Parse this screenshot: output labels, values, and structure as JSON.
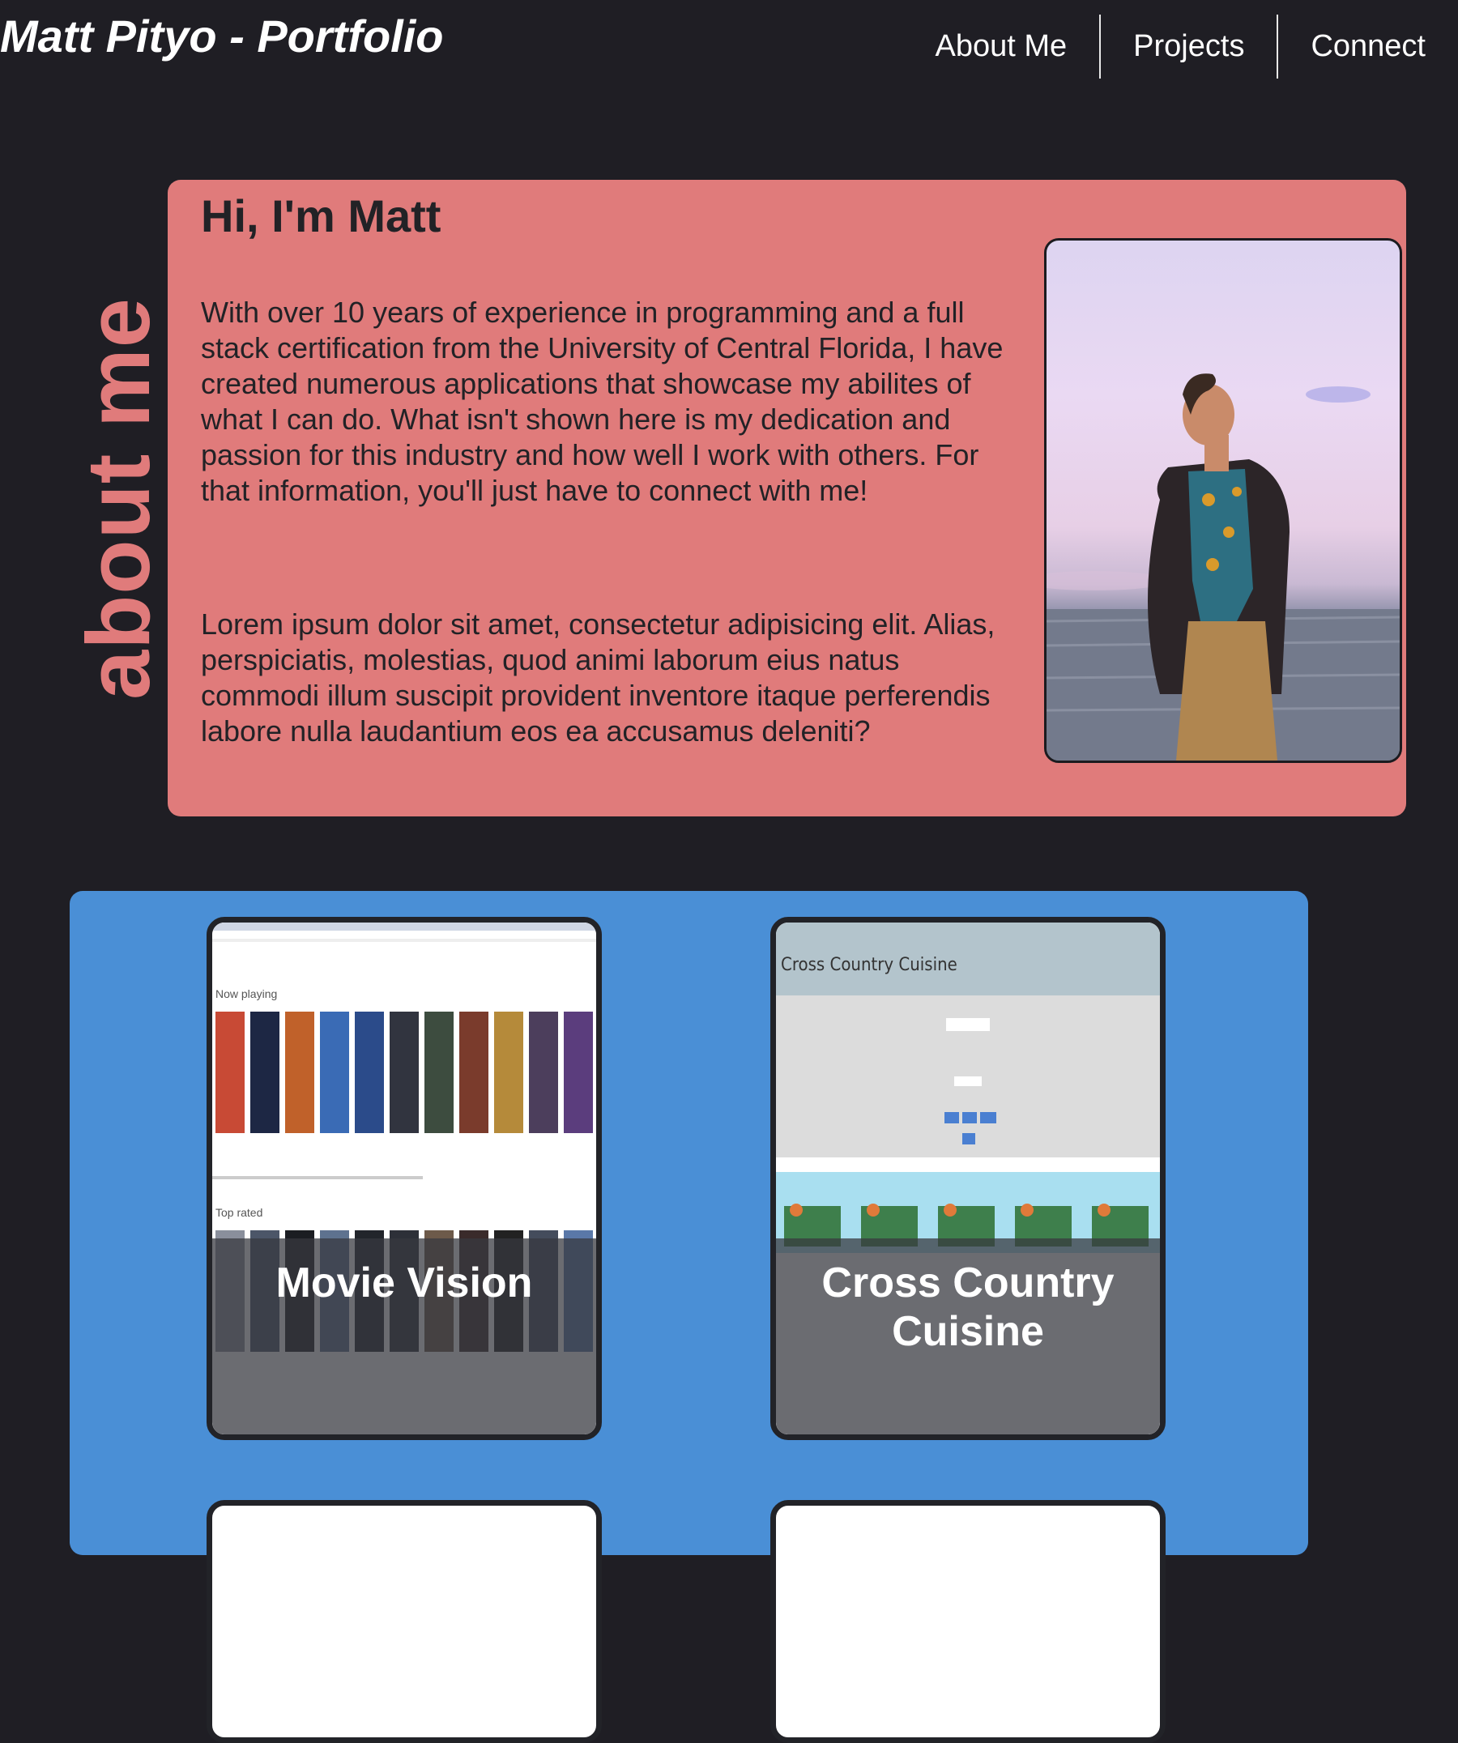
{
  "site": {
    "title": "Matt Pityo - Portfolio"
  },
  "nav": [
    {
      "label": "About Me"
    },
    {
      "label": "Projects"
    },
    {
      "label": "Connect"
    }
  ],
  "about": {
    "side_label": "about me",
    "heading": "Hi, I'm Matt",
    "paragraphs": [
      "With over 10 years of experience in programming and a full stack certification from the University of Central Florida, I have created numerous applications that showcase my abilites of what I can do. What isn't shown here is my dedication and passion for this industry and how well I work with others. For that information, you'll just have to connect with me!",
      "Lorem ipsum dolor sit amet, consectetur adipisicing elit. Alias, perspiciatis, molestias, quod animi laborum eius natus commodi illum suscipit provident inventore itaque perferendis labore nulla laudantium eos ea accusamus deleniti?"
    ]
  },
  "projects": [
    {
      "title": "Movie Vision",
      "thumb_labels": [
        "Now playing",
        "Top rated"
      ]
    },
    {
      "title": "Cross Country Cuisine",
      "thumb_labels": [
        "Cross Country Cuisine"
      ]
    }
  ],
  "colors": {
    "background": "#1f1e24",
    "about_card": "#e07b7b",
    "projects_panel": "#4a8fd6",
    "card_border": "#222328"
  }
}
